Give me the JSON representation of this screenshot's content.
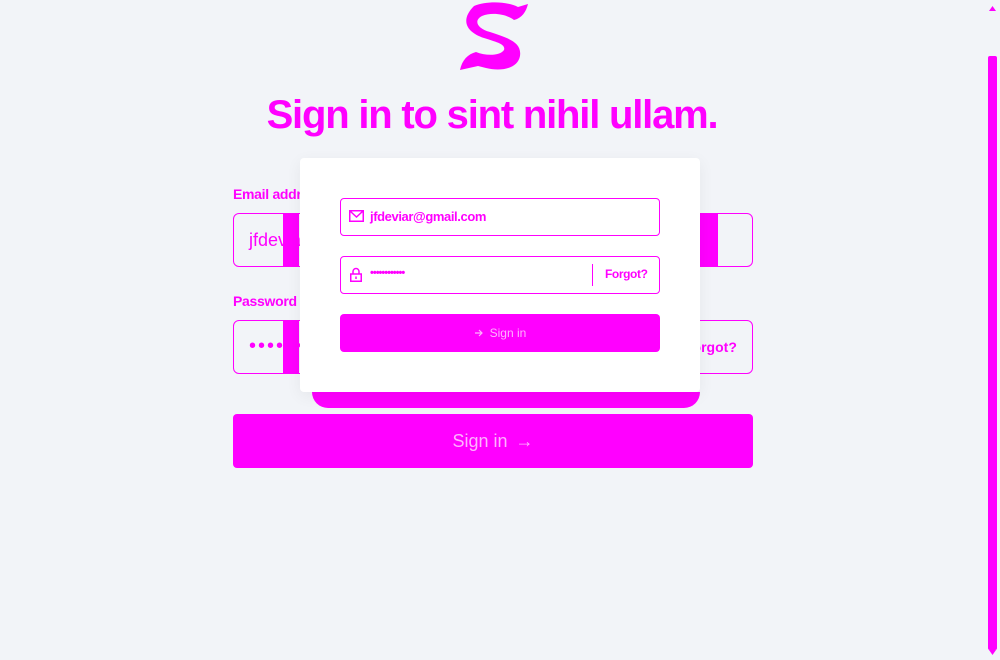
{
  "heading": {
    "title": "Sign in to sint nihil ullam."
  },
  "form": {
    "email_label": "Email address",
    "email_value": "jfdeviar@gmail.com",
    "password_label": "Password",
    "password_dots": "•••••••••",
    "forgot_label": "Forgot?",
    "submit_label": "Sign in",
    "submit_arrow": "→"
  },
  "preview_card": {
    "email_value": "jfdeviar@gmail.com",
    "password_dots": "••••••••••••",
    "forgot_label": "Forgot?",
    "submit_label": "Sign in"
  },
  "icons": {
    "logo": "brand-logo-icon",
    "mail": "mail-icon",
    "lock": "lock-icon",
    "arrow": "arrow-right-icon",
    "signin": "sign-in-icon"
  },
  "colors": {
    "accent": "#ff00ff",
    "background": "#f2f4f8",
    "card": "#ffffff",
    "button_text": "#ffb3ff"
  }
}
